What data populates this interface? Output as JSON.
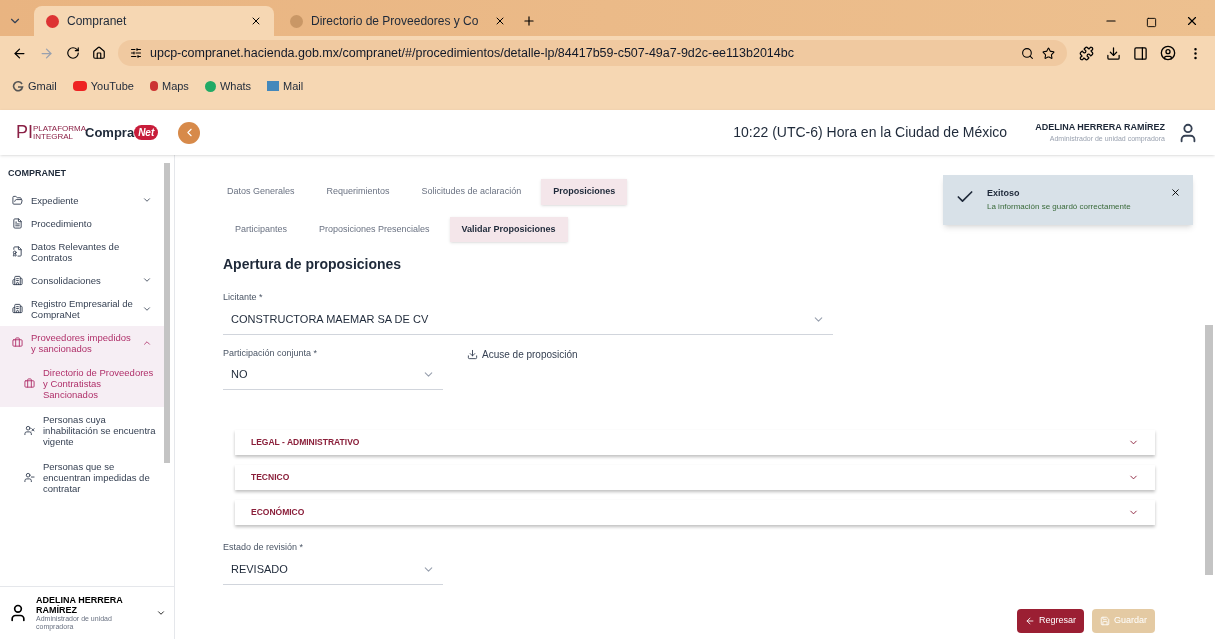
{
  "browser": {
    "tabs": [
      {
        "label": "Compranet",
        "selected": true
      },
      {
        "label": "Directorio de Proveedores y Co",
        "selected": false
      }
    ],
    "url": "upcp-compranet.hacienda.gob.mx/compranet/#/procedimientos/detalle-lp/84417b59-c507-49a7-9d2c-ee113b2014bc",
    "bookmarks": [
      "Gmail",
      "YouTube",
      "Maps",
      "Whats",
      "Mail"
    ]
  },
  "header": {
    "logo": {
      "mark": "PI",
      "small": "PLATAFORMA INTEGRAL",
      "name": "Compra",
      "badge": "Net"
    },
    "clock": "10:22 (UTC-6) Hora en la Ciudad de México",
    "user_name": "ADELINA HERRERA RAMÍREZ",
    "user_role": "Administrador de unidad compradora"
  },
  "sidebar": {
    "section": "COMPRANET",
    "items": [
      {
        "label": "Expediente",
        "expandable": true,
        "expanded": false,
        "selected": false
      },
      {
        "label": "Procedimiento",
        "expandable": false,
        "selected": false
      },
      {
        "label": "Datos Relevantes de Contratos",
        "expandable": false,
        "selected": false
      },
      {
        "label": "Consolidaciones",
        "expandable": true,
        "expanded": false,
        "selected": false
      },
      {
        "label": "Registro Empresarial de CompraNet",
        "expandable": true,
        "expanded": false,
        "selected": false
      },
      {
        "label": "Proveedores impedidos y sancionados",
        "expandable": true,
        "expanded": true,
        "selected": true,
        "children": [
          {
            "label": "Directorio de Proveedores y Contratistas Sancionados",
            "selected": true
          },
          {
            "label": "Personas cuya inhabilitación se encuentra vigente",
            "selected": false
          },
          {
            "label": "Personas que se encuentran impedidas de contratar",
            "selected": false
          }
        ]
      }
    ],
    "user": {
      "name": "ADELINA HERRERA RAMÍREZ",
      "role": "Administrador de unidad compradora"
    }
  },
  "tabs": [
    {
      "label": "Datos Generales",
      "selected": false
    },
    {
      "label": "Requerimientos",
      "selected": false
    },
    {
      "label": "Solicitudes de aclaración",
      "selected": false
    },
    {
      "label": "Proposiciones",
      "selected": true
    }
  ],
  "subtabs": [
    {
      "label": "Participantes",
      "selected": false
    },
    {
      "label": "Proposiciones Presenciales",
      "selected": false
    },
    {
      "label": "Validar Proposiciones",
      "selected": true
    }
  ],
  "toast": {
    "title": "Exitoso",
    "message": "La información se guardó correctamente"
  },
  "form": {
    "title": "Apertura de proposiciones",
    "licitante": {
      "label": "Licitante *",
      "value": "CONSTRUCTORA MAEMAR SA DE CV"
    },
    "participacion": {
      "label": "Participación conjunta *",
      "value": "NO"
    },
    "acuse_link": "Acuse de proposición",
    "sections": [
      {
        "label": "LEGAL - ADMINISTRATIVO",
        "expanded": false
      },
      {
        "label": "TECNICO",
        "expanded": false
      },
      {
        "label": "ECONÓMICO",
        "expanded": false
      }
    ],
    "estado": {
      "label": "Estado de revisión *",
      "value": "REVISADO"
    }
  },
  "buttons": [
    {
      "label": "Regresar",
      "kind": "back",
      "disabled": false
    },
    {
      "label": "Guardar",
      "kind": "save",
      "disabled": true
    }
  ]
}
